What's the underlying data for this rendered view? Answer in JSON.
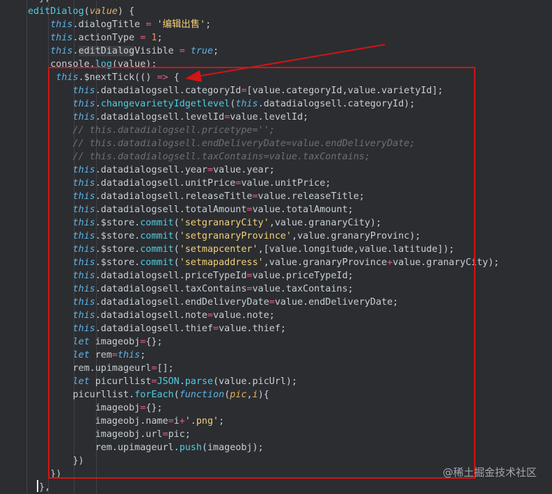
{
  "colors": {
    "background": "#2b2d31",
    "keyword": "#5fb3e6",
    "function": "#4fcde0",
    "string": "#f4d07a",
    "number": "#e8906a",
    "operator": "#e85a8a",
    "param": "#e8b35a",
    "comment": "#6a7177",
    "default": "#c7cfd6",
    "annotation": "#d41414"
  },
  "code": {
    "lines": [
      [
        {
          "t": "  },",
          "c": "txt"
        }
      ],
      [
        {
          "t": "editDialog",
          "c": "fn"
        },
        {
          "t": "(",
          "c": "txt"
        },
        {
          "t": "value",
          "c": "param"
        },
        {
          "t": ") {",
          "c": "txt"
        }
      ],
      [
        {
          "t": "    "
        },
        {
          "t": "this",
          "c": "kw"
        },
        {
          "t": ".dialogTitle ",
          "c": "txt"
        },
        {
          "t": "=",
          "c": "op"
        },
        {
          "t": " ",
          "c": "txt"
        },
        {
          "t": "'编辑出售'",
          "c": "str"
        },
        {
          "t": ";",
          "c": "txt"
        }
      ],
      [
        {
          "t": "    "
        },
        {
          "t": "this",
          "c": "kw"
        },
        {
          "t": ".actionType ",
          "c": "txt"
        },
        {
          "t": "=",
          "c": "op"
        },
        {
          "t": " ",
          "c": "txt"
        },
        {
          "t": "1",
          "c": "num"
        },
        {
          "t": ";",
          "c": "txt"
        }
      ],
      [
        {
          "t": "    "
        },
        {
          "t": "this",
          "c": "kw"
        },
        {
          "t": ".",
          "c": "txt"
        },
        {
          "t": "editDialog",
          "c": "hl"
        },
        {
          "t": "Visible ",
          "c": "txt"
        },
        {
          "t": "=",
          "c": "op"
        },
        {
          "t": " ",
          "c": "txt"
        },
        {
          "t": "true",
          "c": "kw"
        },
        {
          "t": ";",
          "c": "txt"
        }
      ],
      [
        {
          "t": "    "
        },
        {
          "t": "console.",
          "c": "txt"
        },
        {
          "t": "log",
          "c": "fn"
        },
        {
          "t": "(value);",
          "c": "txt"
        }
      ],
      [
        {
          "t": "     "
        },
        {
          "t": "this",
          "c": "kw"
        },
        {
          "t": ".$nextTick(() ",
          "c": "txt"
        },
        {
          "t": "=>",
          "c": "op"
        },
        {
          "t": " {",
          "c": "txt"
        }
      ],
      [
        {
          "t": "        "
        },
        {
          "t": "this",
          "c": "kw"
        },
        {
          "t": ".datadialogsell.categoryId",
          "c": "txt"
        },
        {
          "t": "=",
          "c": "op"
        },
        {
          "t": "[value.categoryId,value.varietyId];",
          "c": "txt"
        }
      ],
      [
        {
          "t": "        "
        },
        {
          "t": "this",
          "c": "kw"
        },
        {
          "t": ".",
          "c": "txt"
        },
        {
          "t": "changevarietyIdgetlevel",
          "c": "fn"
        },
        {
          "t": "(",
          "c": "txt"
        },
        {
          "t": "this",
          "c": "kw"
        },
        {
          "t": ".datadialogsell.categoryId);",
          "c": "txt"
        }
      ],
      [
        {
          "t": "        "
        },
        {
          "t": "this",
          "c": "kw"
        },
        {
          "t": ".datadialogsell.levelId",
          "c": "txt"
        },
        {
          "t": "=",
          "c": "op"
        },
        {
          "t": "value.levelId;",
          "c": "txt"
        }
      ],
      [
        {
          "t": "        "
        },
        {
          "t": "// this.datadialogsell.pricetype='';",
          "c": "cm"
        }
      ],
      [
        {
          "t": "        "
        },
        {
          "t": "// this.datadialogsell.endDeliveryDate=value.endDeliveryDate;",
          "c": "cm"
        }
      ],
      [
        {
          "t": "        "
        },
        {
          "t": "// this.datadialogsell.taxContains=value.taxContains;",
          "c": "cm"
        }
      ],
      [
        {
          "t": "        "
        },
        {
          "t": "this",
          "c": "kw"
        },
        {
          "t": ".datadialogsell.year",
          "c": "txt"
        },
        {
          "t": "=",
          "c": "op"
        },
        {
          "t": "value.year;",
          "c": "txt"
        }
      ],
      [
        {
          "t": "        "
        },
        {
          "t": "this",
          "c": "kw"
        },
        {
          "t": ".datadialogsell.unitPrice",
          "c": "txt"
        },
        {
          "t": "=",
          "c": "op"
        },
        {
          "t": "value.unitPrice;",
          "c": "txt"
        }
      ],
      [
        {
          "t": "        "
        },
        {
          "t": "this",
          "c": "kw"
        },
        {
          "t": ".datadialogsell.releaseTitle",
          "c": "txt"
        },
        {
          "t": "=",
          "c": "op"
        },
        {
          "t": "value.releaseTitle;",
          "c": "txt"
        }
      ],
      [
        {
          "t": "        "
        },
        {
          "t": "this",
          "c": "kw"
        },
        {
          "t": ".datadialogsell.totalAmount",
          "c": "txt"
        },
        {
          "t": "=",
          "c": "op"
        },
        {
          "t": "value.totalAmount;",
          "c": "txt"
        }
      ],
      [
        {
          "t": "        "
        },
        {
          "t": "this",
          "c": "kw"
        },
        {
          "t": ".$store.",
          "c": "txt"
        },
        {
          "t": "commit",
          "c": "fn"
        },
        {
          "t": "(",
          "c": "txt"
        },
        {
          "t": "'setgranaryCity'",
          "c": "str"
        },
        {
          "t": ",value.granaryCity);",
          "c": "txt"
        }
      ],
      [
        {
          "t": "        "
        },
        {
          "t": "this",
          "c": "kw"
        },
        {
          "t": ".$store.",
          "c": "txt"
        },
        {
          "t": "commit",
          "c": "fn"
        },
        {
          "t": "(",
          "c": "txt"
        },
        {
          "t": "'setgranaryProvince'",
          "c": "str"
        },
        {
          "t": ",value.granaryProvinc);",
          "c": "txt"
        }
      ],
      [
        {
          "t": "        "
        },
        {
          "t": "this",
          "c": "kw"
        },
        {
          "t": ".$store.",
          "c": "txt"
        },
        {
          "t": "commit",
          "c": "fn"
        },
        {
          "t": "(",
          "c": "txt"
        },
        {
          "t": "'setmapcenter'",
          "c": "str"
        },
        {
          "t": ",[value.longitude,value.latitude]);",
          "c": "txt"
        }
      ],
      [
        {
          "t": "        "
        },
        {
          "t": "this",
          "c": "kw"
        },
        {
          "t": ".$store.",
          "c": "txt"
        },
        {
          "t": "commit",
          "c": "fn"
        },
        {
          "t": "(",
          "c": "txt"
        },
        {
          "t": "'setmapaddress'",
          "c": "str"
        },
        {
          "t": ",value.granaryProvince",
          "c": "txt"
        },
        {
          "t": "+",
          "c": "op"
        },
        {
          "t": "value.granaryCity);",
          "c": "txt"
        }
      ],
      [
        {
          "t": "        "
        },
        {
          "t": "this",
          "c": "kw"
        },
        {
          "t": ".datadialogsell.priceTypeId",
          "c": "txt"
        },
        {
          "t": "=",
          "c": "op"
        },
        {
          "t": "value.priceTypeId;",
          "c": "txt"
        }
      ],
      [
        {
          "t": "        "
        },
        {
          "t": "this",
          "c": "kw"
        },
        {
          "t": ".datadialogsell.taxContains",
          "c": "txt"
        },
        {
          "t": "=",
          "c": "op"
        },
        {
          "t": "value.taxContains;",
          "c": "txt"
        }
      ],
      [
        {
          "t": "        "
        },
        {
          "t": "this",
          "c": "kw"
        },
        {
          "t": ".datadialogsell.endDeliveryDate",
          "c": "txt"
        },
        {
          "t": "=",
          "c": "op"
        },
        {
          "t": "value.endDeliveryDate;",
          "c": "txt"
        }
      ],
      [
        {
          "t": "        "
        },
        {
          "t": "this",
          "c": "kw"
        },
        {
          "t": ".datadialogsell.note",
          "c": "txt"
        },
        {
          "t": "=",
          "c": "op"
        },
        {
          "t": "value.note;",
          "c": "txt"
        }
      ],
      [
        {
          "t": "        "
        },
        {
          "t": "this",
          "c": "kw"
        },
        {
          "t": ".datadialogsell.thief",
          "c": "txt"
        },
        {
          "t": "=",
          "c": "op"
        },
        {
          "t": "value.thief;",
          "c": "txt"
        }
      ],
      [
        {
          "t": "        "
        },
        {
          "t": "let",
          "c": "kw"
        },
        {
          "t": " imageobj",
          "c": "txt"
        },
        {
          "t": "=",
          "c": "op"
        },
        {
          "t": "{};",
          "c": "txt"
        }
      ],
      [
        {
          "t": "        "
        },
        {
          "t": "let",
          "c": "kw"
        },
        {
          "t": " rem",
          "c": "txt"
        },
        {
          "t": "=",
          "c": "op"
        },
        {
          "t": "this",
          "c": "kw"
        },
        {
          "t": ";",
          "c": "txt"
        }
      ],
      [
        {
          "t": "        "
        },
        {
          "t": "rem.upimageurl",
          "c": "txt"
        },
        {
          "t": "=",
          "c": "op"
        },
        {
          "t": "[];",
          "c": "txt"
        }
      ],
      [
        {
          "t": "        "
        },
        {
          "t": "let",
          "c": "kw"
        },
        {
          "t": " picurllist",
          "c": "txt"
        },
        {
          "t": "=",
          "c": "op"
        },
        {
          "t": "JSON",
          "c": "fn"
        },
        {
          "t": ".",
          "c": "txt"
        },
        {
          "t": "parse",
          "c": "fn"
        },
        {
          "t": "(value.picUrl);",
          "c": "txt"
        }
      ],
      [
        {
          "t": "        "
        },
        {
          "t": "picurllist.",
          "c": "txt"
        },
        {
          "t": "forEach",
          "c": "fn"
        },
        {
          "t": "(",
          "c": "txt"
        },
        {
          "t": "function",
          "c": "kw"
        },
        {
          "t": "(",
          "c": "txt"
        },
        {
          "t": "pic",
          "c": "param"
        },
        {
          "t": ",",
          "c": "txt"
        },
        {
          "t": "i",
          "c": "param"
        },
        {
          "t": "){",
          "c": "txt"
        }
      ],
      [
        {
          "t": "            "
        },
        {
          "t": "imageobj",
          "c": "txt"
        },
        {
          "t": "=",
          "c": "op"
        },
        {
          "t": "{};",
          "c": "txt"
        }
      ],
      [
        {
          "t": "            "
        },
        {
          "t": "imageobj.name",
          "c": "txt"
        },
        {
          "t": "=",
          "c": "op"
        },
        {
          "t": "i",
          "c": "txt"
        },
        {
          "t": "+",
          "c": "op"
        },
        {
          "t": "'.png'",
          "c": "str"
        },
        {
          "t": ";",
          "c": "txt"
        }
      ],
      [
        {
          "t": "            "
        },
        {
          "t": "imageobj.url",
          "c": "txt"
        },
        {
          "t": "=",
          "c": "op"
        },
        {
          "t": "pic;",
          "c": "txt"
        }
      ],
      [
        {
          "t": "            "
        },
        {
          "t": "rem.upimageurl.",
          "c": "txt"
        },
        {
          "t": "push",
          "c": "fn"
        },
        {
          "t": "(imageobj);",
          "c": "txt"
        }
      ],
      [
        {
          "t": "        "
        },
        {
          "t": "})",
          "c": "txt"
        }
      ],
      [
        {
          "t": "    "
        },
        {
          "t": "})",
          "c": "txt"
        }
      ],
      [
        {
          "t": "  },",
          "c": "txt"
        }
      ]
    ]
  },
  "watermark": {
    "text": "@稀土掘金技术社区"
  }
}
